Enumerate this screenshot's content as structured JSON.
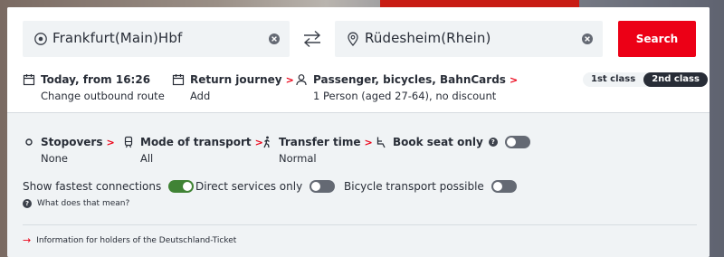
{
  "search": {
    "from_value": "Frankfurt(Main)Hbf",
    "to_value": "Rüdesheim(Rhein)",
    "button_label": "Search"
  },
  "options": {
    "date": {
      "title": "Today, from 16:26",
      "sub": "Change outbound route"
    },
    "return": {
      "title": "Return journey",
      "sub": "Add"
    },
    "passenger": {
      "title": "Passenger, bicycles, BahnCards",
      "sub": "1 Person (aged 27-64), no discount"
    },
    "class_first": "1st class",
    "class_second": "2nd class"
  },
  "advanced": {
    "stopovers": {
      "title": "Stopovers",
      "sub": "None"
    },
    "transport": {
      "title": "Mode of transport",
      "sub": "All"
    },
    "transfer": {
      "title": "Transfer time",
      "sub": "Normal"
    },
    "seat": {
      "title": "Book seat only",
      "enabled": false
    }
  },
  "toggles": {
    "fastest": {
      "label": "Show fastest connections",
      "enabled": true
    },
    "direct": {
      "label": "Direct services only",
      "enabled": false
    },
    "bicycle": {
      "label": "Bicycle transport possible",
      "enabled": false
    }
  },
  "help_text": "What does that mean?",
  "info_link": "Information for holders of the Deutschland-Ticket",
  "colors": {
    "accent": "#ec0016",
    "toggle_on": "#408335",
    "toggle_off": "#646973",
    "dark": "#282d37"
  }
}
